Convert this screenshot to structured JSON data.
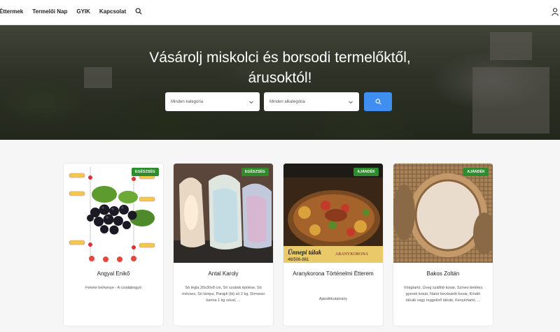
{
  "nav": {
    "items": [
      "Éttermek",
      "Termelői Nap",
      "GYIK",
      "Kapcsolat"
    ]
  },
  "hero": {
    "title_line1": "Vásárolj miskolci és borsodi termelőktől,",
    "title_line2": "árusoktól!",
    "category_placeholder": "Minden kategória",
    "subcategory_placeholder": "Minden alkategória"
  },
  "colors": {
    "accent": "#3f8ff0",
    "badge_green": "#2e8b2e"
  },
  "cards": [
    {
      "badge": "EGÉSZSÉG",
      "name": "Angyal Enikő",
      "desc": "Fekete berkenye - A csodabogyó"
    },
    {
      "badge": "EGÉSZSÉG",
      "name": "Antal Karoly",
      "desc": "Só tégla 20x30x8 cm, Só szobák építése, Só mécses, Só lámpa, Parajdi (bi) só 2 kg, Drmoosi kanna 1 kg sóval, ..."
    },
    {
      "badge": "AJÁNDÉK",
      "name": "Aranykorona Történelmi Étterem",
      "desc": "Ajándékutalvány",
      "image_text_1": "Ünnepi tálak",
      "image_text_2": "ARANYKORONA",
      "image_text_3": "46/506-881"
    },
    {
      "badge": "AJÁNDÉK",
      "name": "Bakos Zoltán",
      "desc": "Virágtartó, Üveg szállító kosár, Színes betétes gyerek kosár, Natúr bevásárló kosár, Kínáló tálcák vagy reggeliző tálcák, Kenyértartó, ..."
    }
  ]
}
